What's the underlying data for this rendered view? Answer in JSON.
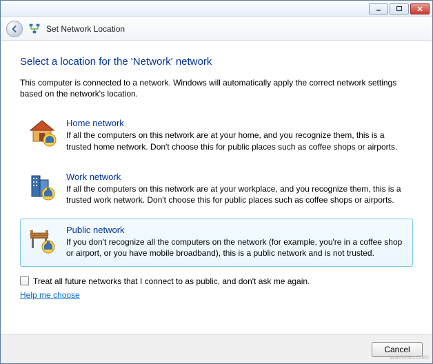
{
  "window": {
    "title": "Set Network Location"
  },
  "main": {
    "instruction": "Select a location for the 'Network' network",
    "description": "This computer is connected to a network. Windows will automatically apply the correct network settings based on the network's location.",
    "options": [
      {
        "title": "Home network",
        "desc": "If all the computers on this network are at your home, and you recognize them, this is a trusted home network.  Don't choose this for public places such as coffee shops or airports."
      },
      {
        "title": "Work network",
        "desc": "If all the computers on this network are at your workplace, and you recognize them, this is a trusted work network.  Don't choose this for public places such as coffee shops or airports."
      },
      {
        "title": "Public network",
        "desc": "If you don't recognize all the computers on the network (for example, you're in a coffee shop or airport, or you have mobile broadband), this is a public network and is not trusted."
      }
    ],
    "checkbox_label": "Treat all future networks that I connect to as public, and don't ask me again.",
    "help_link": "Help me choose"
  },
  "footer": {
    "cancel": "Cancel"
  },
  "watermark": "wsxwsn.com"
}
